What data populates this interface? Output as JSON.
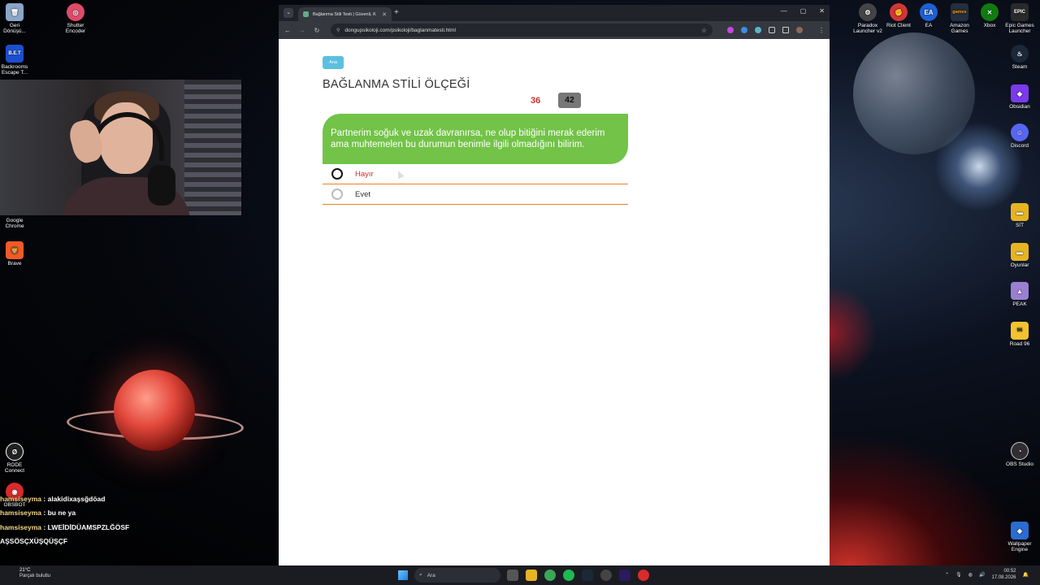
{
  "desktop_left": [
    {
      "name": "recycle-bin",
      "label": "Geri\nDönüşü...",
      "color": "#8aa6c8"
    },
    {
      "name": "shutter-encoder",
      "label": "Shutter\nEncoder",
      "color": "#e04a6a"
    },
    {
      "name": "backrooms",
      "label": "Backrooms\nEscape T...",
      "color": "#1b4fd0"
    },
    {
      "name": "google-chrome",
      "label": "Google\nChrome",
      "color": "#3aa757"
    },
    {
      "name": "brave",
      "label": "Brave",
      "color": "#f05a28"
    },
    {
      "name": "rode-connect",
      "label": "RODE\nConnect",
      "color": "#222222"
    },
    {
      "name": "obsbot",
      "label": "OBSBOT",
      "color": "#d92b2b"
    }
  ],
  "desktop_right": [
    {
      "name": "paradox-launcher",
      "label": "Paradox\nLauncher v2",
      "color": "#444444"
    },
    {
      "name": "riot-client",
      "label": "Riot Client",
      "color": "#d13639"
    },
    {
      "name": "ea",
      "label": "EA",
      "color": "#1e60d6"
    },
    {
      "name": "amazon-games",
      "label": "Amazon\nGames",
      "color": "#ff9900"
    },
    {
      "name": "xbox",
      "label": "Xbox",
      "color": "#107c10"
    },
    {
      "name": "epic-games",
      "label": "Epic Games\nLauncher",
      "color": "#2a2a2a"
    },
    {
      "name": "steam",
      "label": "Steam",
      "color": "#1b2838"
    },
    {
      "name": "obsidian",
      "label": "Obsidian",
      "color": "#7c3aed"
    },
    {
      "name": "discord",
      "label": "Discord",
      "color": "#5865f2"
    },
    {
      "name": "sit",
      "label": "SİT",
      "color": "#e6b422"
    },
    {
      "name": "oyunlar",
      "label": "Oyunlar",
      "color": "#e6b422"
    },
    {
      "name": "peak",
      "label": "PEAK",
      "color": "#9b7fd1"
    },
    {
      "name": "road-96",
      "label": "Road 96",
      "color": "#f2c230"
    },
    {
      "name": "obs-studio",
      "label": "OBS Studio",
      "color": "#302e31"
    },
    {
      "name": "wallpaper-engine",
      "label": "Wallpaper\nEngine",
      "color": "#2b6cd0"
    }
  ],
  "chat": [
    {
      "user": "hamsiseyma",
      "message": "alakidixaşsğdöad"
    },
    {
      "user": "hamsiseyma",
      "message": "bu ne ya"
    },
    {
      "user": "hamsiseyma",
      "message": "LWEİDİDÜAMSPZLĞÖSF"
    },
    {
      "user": "",
      "message": "AŞSÖSÇXÜŞQÜŞÇF"
    }
  ],
  "browser": {
    "tab_title": "Bağlanma Stili Testi | Güvenli, K",
    "url": "dongupsikoloji.com/psikoloji/baglanmatesti.html"
  },
  "page": {
    "home_label": "Ana",
    "title": "BAĞLANMA STİLİ ÖLÇEĞİ",
    "current_question": "36",
    "total_questions": "42",
    "question_text": "Partnerim soğuk ve uzak davranırsa, ne olup bitiğini merak ederim ama muhtemelen bu durumun benimle ilgili olmadığını bilirim.",
    "options": [
      {
        "label": "Hayır",
        "state": "hover"
      },
      {
        "label": "Evet",
        "state": "default"
      }
    ],
    "colors": {
      "question_bg": "#72c347",
      "divider": "#e8822a",
      "counter_red": "#c9302c",
      "home_btn": "#5bc0de"
    }
  },
  "taskbar": {
    "weather_temp": "21°C",
    "weather_desc": "Parçalı bulutlu",
    "search_placeholder": "Ara",
    "time": "00:52",
    "date": "17.08.2026"
  }
}
